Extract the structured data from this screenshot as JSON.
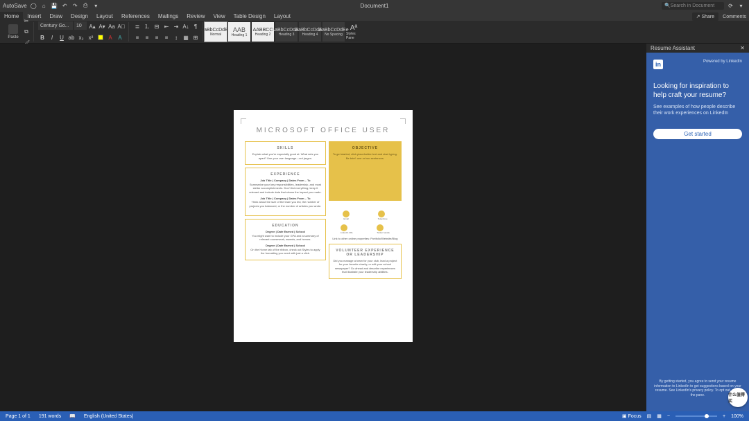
{
  "titlebar": {
    "autosave": "AutoSave",
    "doc_title": "Document1",
    "search_placeholder": "Search in Document"
  },
  "tabs": {
    "items": [
      "Home",
      "Insert",
      "Draw",
      "Design",
      "Layout",
      "References",
      "Mailings",
      "Review",
      "View",
      "Table Design",
      "Layout"
    ],
    "share": "Share",
    "comments": "Comments"
  },
  "ribbon": {
    "paste": "Paste",
    "font_name": "Century Go...",
    "font_size": "10",
    "styles": [
      {
        "preview": "AaBbCcDdEe",
        "label": "Normal"
      },
      {
        "preview": "AAB",
        "label": "Heading 1"
      },
      {
        "preview": "AABBCC",
        "label": "Heading 2"
      },
      {
        "preview": "AaBbCcDdEe",
        "label": "Heading 3"
      },
      {
        "preview": "AaBbCcDdEe",
        "label": "Heading 4"
      },
      {
        "preview": "AaBbCcDdEe",
        "label": "No Spacing"
      }
    ],
    "styles_pane": "Styles\nPane"
  },
  "page": {
    "title": "MICROSOFT OFFICE USER",
    "skills_h": "SKILLS",
    "skills_b": "Explain what you're especially good at. What sets you apart? Use your own language—not jargon.",
    "objective_h": "OBJECTIVE",
    "objective_b": "To get started, click placeholder text and start typing. Be brief: one or two sentences.",
    "exp_h": "EXPERIENCE",
    "exp_job": "Job Title | Company | Dates From – To",
    "exp_b1": "Summarize your key responsibilities, leadership, and most stellar accomplishments. Don't list everything; keep it relevant and include data that shows the impact you made.",
    "exp_b2": "Think about the size of the team you led, the number of projects you balanced, or the number of articles you wrote.",
    "edu_h": "EDUCATION",
    "edu_deg": "Degree | Date Earned | School",
    "edu_b1": "You might want to include your GPA and a summary of relevant coursework, awards, and honors.",
    "edu_b2": "On the Home tab of the ribbon, check out Styles to apply the formatting you need with just a click.",
    "contact_email": "Email",
    "contact_tel": "Telephone",
    "contact_li": "LinkedIn URL",
    "contact_tw": "Twitter handle",
    "contact_link": "Link to other online properties: Portfolio/Website/Blog",
    "vol_h": "VOLUNTEER EXPERIENCE OR LEADERSHIP",
    "vol_b": "Did you manage a team for your club, lead a project for your favorite charity, or edit your school newspaper? Go ahead and describe experiences that illustrate your leadership abilities."
  },
  "sidepane": {
    "title": "Resume Assistant",
    "powered": "Powered by LinkedIn",
    "heading": "Looking for inspiration to help craft your resume?",
    "sub": "See examples of how people describe their work experiences on LinkedIn",
    "button": "Get started",
    "legal": "By getting started, you agree to send your resume information to LinkedIn to get suggestions based on your resume. See LinkedIn's privacy policy. To opt out, close the pane."
  },
  "status": {
    "page": "Page 1 of 1",
    "words": "191 words",
    "lang": "English (United States)",
    "focus": "Focus",
    "zoom": "100%"
  },
  "watermark": "什么值得买"
}
